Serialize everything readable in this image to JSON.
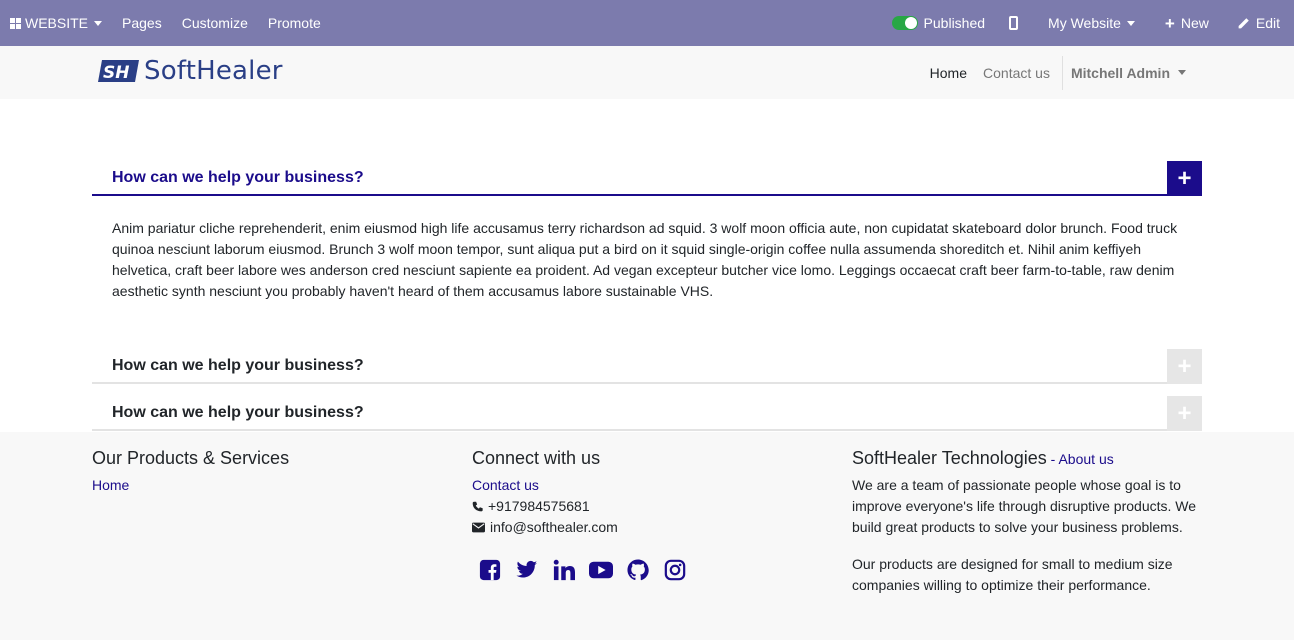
{
  "editbar": {
    "website_label": "WEBSITE",
    "pages_label": "Pages",
    "customize_label": "Customize",
    "promote_label": "Promote",
    "published_label": "Published",
    "my_website_label": "My Website",
    "new_label": "New",
    "edit_label": "Edit"
  },
  "header": {
    "logo_text": "SoftHealer",
    "nav": {
      "home": "Home",
      "contact": "Contact us",
      "user": "Mitchell Admin"
    }
  },
  "accordion": {
    "items": [
      {
        "title": "How can we help your business?",
        "open": true,
        "body": "Anim pariatur cliche reprehenderit, enim eiusmod high life accusamus terry richardson ad squid. 3 wolf moon officia aute, non cupidatat skateboard dolor brunch. Food truck quinoa nesciunt laborum eiusmod. Brunch 3 wolf moon tempor, sunt aliqua put a bird on it squid single-origin coffee nulla assumenda shoreditch et. Nihil anim keffiyeh helvetica, craft beer labore wes anderson cred nesciunt sapiente ea proident. Ad vegan excepteur butcher vice lomo. Leggings occaecat craft beer farm-to-table, raw denim aesthetic synth nesciunt you probably haven't heard of them accusamus labore sustainable VHS."
      },
      {
        "title": "How can we help your business?",
        "open": false
      },
      {
        "title": "How can we help your business?",
        "open": false
      }
    ]
  },
  "footer": {
    "products": {
      "heading": "Our Products & Services",
      "home_link": "Home"
    },
    "connect": {
      "heading": "Connect with us",
      "contact_link": "Contact us",
      "phone": "+917984575681",
      "email": "info@softhealer.com"
    },
    "about": {
      "heading": "SoftHealer Technologies",
      "separator": " - ",
      "about_link": "About us",
      "para1": "We are a team of passionate people whose goal is to improve everyone's life through disruptive products. We build great products to solve your business problems.",
      "para2": "Our products are designed for small to medium size companies willing to optimize their performance."
    }
  },
  "colors": {
    "editbar_bg": "#7c7bad",
    "accent": "#1b0c8b",
    "logo": "#2a3f86",
    "published_toggle": "#28a745"
  },
  "icons": [
    "grid-icon",
    "mobile-icon",
    "plus-icon",
    "pencil-icon",
    "phone-icon",
    "envelope-icon",
    "facebook-icon",
    "twitter-icon",
    "linkedin-icon",
    "youtube-icon",
    "github-icon",
    "instagram-icon"
  ]
}
